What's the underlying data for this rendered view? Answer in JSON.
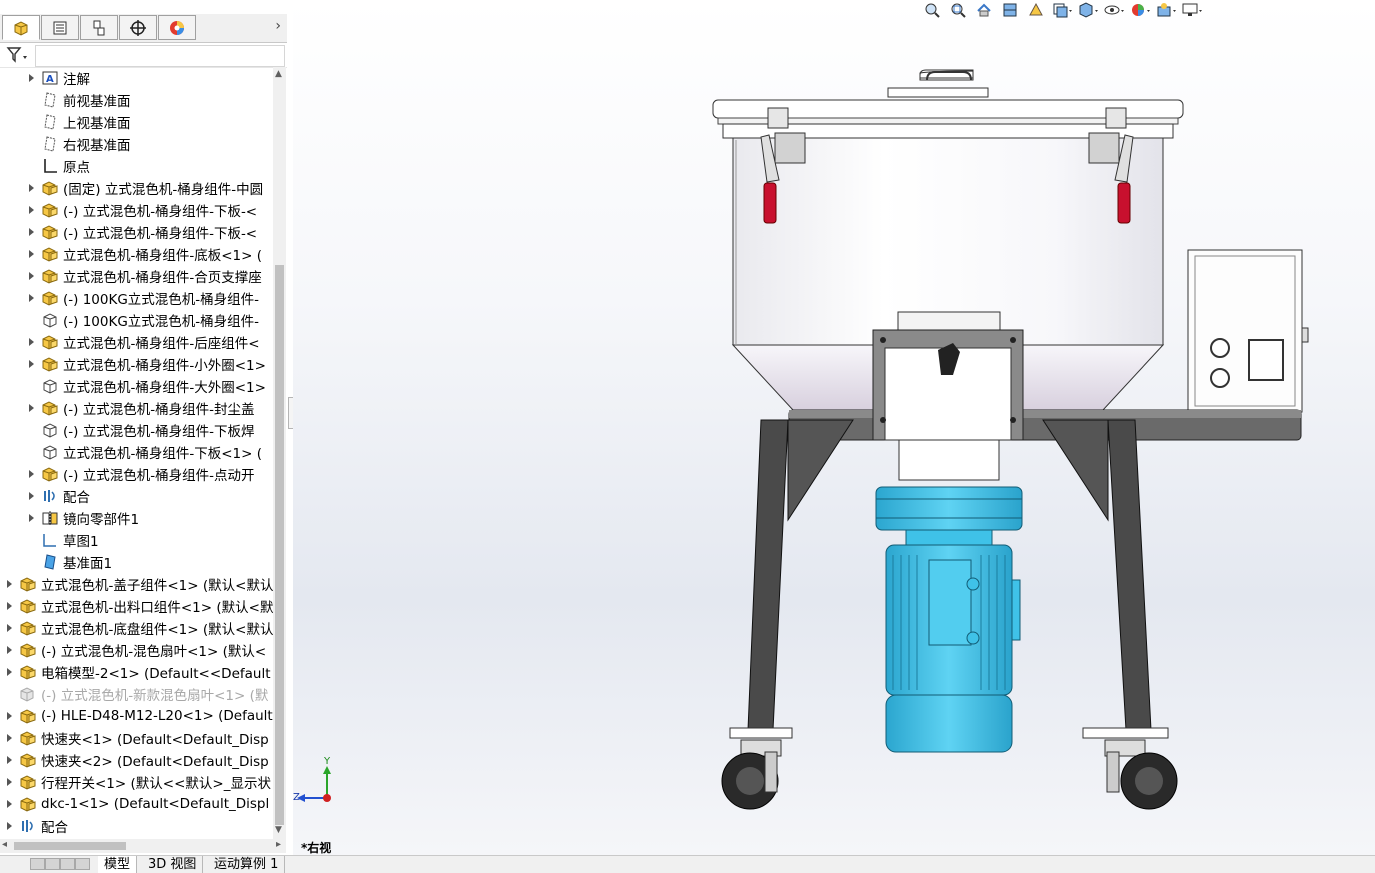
{
  "feature_manager": {
    "tabs": [
      {
        "name": "feature-manager-tab",
        "icon": "assembly-icon",
        "active": true
      },
      {
        "name": "property-manager-tab",
        "icon": "property-icon"
      },
      {
        "name": "configuration-manager-tab",
        "icon": "configuration-icon"
      },
      {
        "name": "dimxpert-tab",
        "icon": "crosshair-icon"
      },
      {
        "name": "display-manager-tab",
        "icon": "display-icon"
      }
    ],
    "filter_placeholder": "",
    "tree": [
      {
        "level": 1,
        "expand": true,
        "icon": "annotation",
        "label": "注解"
      },
      {
        "level": 1,
        "expand": false,
        "icon": "plane",
        "label": "前视基准面"
      },
      {
        "level": 1,
        "expand": false,
        "icon": "plane",
        "label": "上视基准面"
      },
      {
        "level": 1,
        "expand": false,
        "icon": "plane",
        "label": "右视基准面"
      },
      {
        "level": 1,
        "expand": false,
        "icon": "origin",
        "label": "原点"
      },
      {
        "level": 1,
        "expand": true,
        "icon": "assembly",
        "label": "(固定) 立式混色机-桶身组件-中圆"
      },
      {
        "level": 1,
        "expand": true,
        "icon": "assembly",
        "label": "(-) 立式混色机-桶身组件-下板-<"
      },
      {
        "level": 1,
        "expand": true,
        "icon": "assembly",
        "label": "(-) 立式混色机-桶身组件-下板-<"
      },
      {
        "level": 1,
        "expand": true,
        "icon": "assembly",
        "label": "立式混色机-桶身组件-底板<1> ("
      },
      {
        "level": 1,
        "expand": true,
        "icon": "assembly",
        "label": "立式混色机-桶身组件-合页支撑座"
      },
      {
        "level": 1,
        "expand": true,
        "icon": "assembly",
        "label": "(-) 100KG立式混色机-桶身组件-"
      },
      {
        "level": 1,
        "expand": false,
        "icon": "part",
        "label": "(-) 100KG立式混色机-桶身组件-"
      },
      {
        "level": 1,
        "expand": true,
        "icon": "assembly",
        "label": "立式混色机-桶身组件-后座组件<"
      },
      {
        "level": 1,
        "expand": true,
        "icon": "assembly",
        "label": "立式混色机-桶身组件-小外圈<1>"
      },
      {
        "level": 1,
        "expand": false,
        "icon": "part",
        "label": "立式混色机-桶身组件-大外圈<1>"
      },
      {
        "level": 1,
        "expand": true,
        "icon": "assembly",
        "label": "(-) 立式混色机-桶身组件-封尘盖"
      },
      {
        "level": 1,
        "expand": false,
        "icon": "part",
        "label": "(-) 立式混色机-桶身组件-下板焊"
      },
      {
        "level": 1,
        "expand": false,
        "icon": "part",
        "label": "立式混色机-桶身组件-下板<1> ("
      },
      {
        "level": 1,
        "expand": true,
        "icon": "assembly",
        "label": "(-) 立式混色机-桶身组件-点动开"
      },
      {
        "level": 1,
        "expand": true,
        "icon": "mate",
        "label": "配合"
      },
      {
        "level": 1,
        "expand": true,
        "icon": "mirror",
        "label": "镜向零部件1"
      },
      {
        "level": 1,
        "expand": false,
        "icon": "sketch",
        "label": "草图1"
      },
      {
        "level": 1,
        "expand": false,
        "icon": "plane-blue",
        "label": "基准面1"
      },
      {
        "level": 0,
        "expand": true,
        "icon": "assembly",
        "label": "立式混色机-盖子组件<1> (默认<默认"
      },
      {
        "level": 0,
        "expand": true,
        "icon": "assembly",
        "label": "立式混色机-出料口组件<1> (默认<默"
      },
      {
        "level": 0,
        "expand": true,
        "icon": "assembly",
        "label": "立式混色机-底盘组件<1> (默认<默认"
      },
      {
        "level": 0,
        "expand": true,
        "icon": "assembly",
        "label": "(-) 立式混色机-混色扇叶<1> (默认<"
      },
      {
        "level": 0,
        "expand": true,
        "icon": "assembly",
        "label": "电箱模型-2<1> (Default<<Default"
      },
      {
        "level": 0,
        "expand": false,
        "icon": "assembly-dim",
        "label": "(-) 立式混色机-新款混色扇叶<1> (默",
        "dim": true
      },
      {
        "level": 0,
        "expand": true,
        "icon": "assembly",
        "label": "(-) HLE-D48-M12-L20<1> (Default"
      },
      {
        "level": 0,
        "expand": true,
        "icon": "assembly",
        "label": "快速夹<1> (Default<Default_Disp"
      },
      {
        "level": 0,
        "expand": true,
        "icon": "assembly",
        "label": "快速夹<2> (Default<Default_Disp"
      },
      {
        "level": 0,
        "expand": true,
        "icon": "assembly",
        "label": "行程开关<1> (默认<<默认>_显示状"
      },
      {
        "level": 0,
        "expand": true,
        "icon": "assembly",
        "label": "dkc-1<1> (Default<Default_Displ"
      },
      {
        "level": 0,
        "expand": true,
        "icon": "mate",
        "label": "配合"
      }
    ]
  },
  "viewport": {
    "view_label": "*右视",
    "triad": {
      "y": "Y",
      "z": "Z"
    },
    "toolbar": [
      "zoom-to-fit-icon",
      "zoom-area-icon",
      "previous-view-icon",
      "section-view-icon",
      "dynamic-annotation-icon",
      "view-orientation-icon",
      "display-style-icon",
      "hide-show-icon",
      "edit-appearance-icon",
      "apply-scene-icon",
      "view-settings-icon"
    ]
  },
  "bottom_tabs": {
    "tabs": [
      "模型",
      "3D 视图",
      "运动算例 1"
    ],
    "active": "模型"
  },
  "colors": {
    "motor": "#3fc2e8",
    "frame": "#4a4a4a",
    "drum": "#ffffff",
    "clamp_red": "#c8102e"
  }
}
